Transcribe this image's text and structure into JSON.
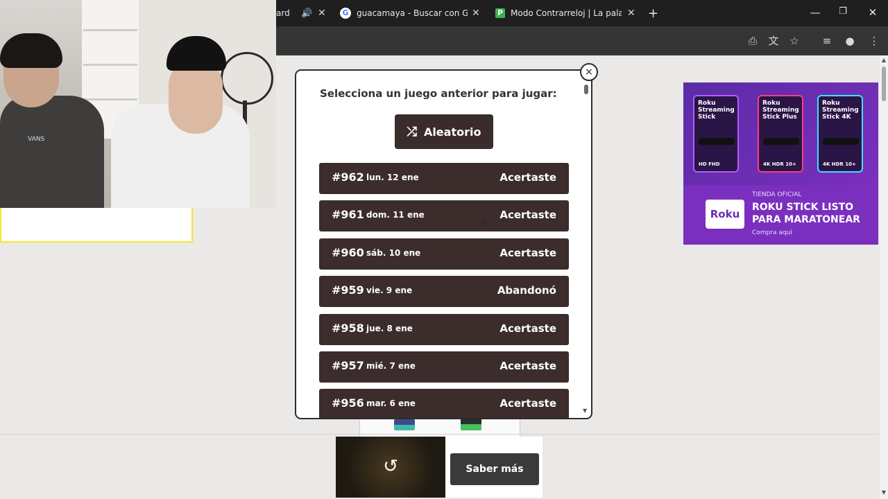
{
  "browser": {
    "tabs": [
      {
        "title": "ard",
        "favicon": "",
        "audio": true
      },
      {
        "title": "guacamaya - Buscar con Googl",
        "favicon": "G"
      },
      {
        "title": "Modo Contrarreloj | La palabra",
        "favicon": "P"
      }
    ],
    "new_tab": "+",
    "window_controls": {
      "minimize": "—",
      "restore": "❐",
      "close": "✕"
    }
  },
  "modal": {
    "title": "Selecciona un juego anterior para jugar:",
    "random_button": "Aleatorio",
    "close": "×",
    "games": [
      {
        "num": "#962",
        "date": "lun. 12 ene",
        "status": "Acertaste"
      },
      {
        "num": "#961",
        "date": "dom. 11 ene",
        "status": "Acertaste"
      },
      {
        "num": "#960",
        "date": "sáb. 10 ene",
        "status": "Acertaste"
      },
      {
        "num": "#959",
        "date": "vie. 9 ene",
        "status": "Abandonó"
      },
      {
        "num": "#958",
        "date": "jue. 8 ene",
        "status": "Acertaste"
      },
      {
        "num": "#957",
        "date": "mié. 7 ene",
        "status": "Acertaste"
      },
      {
        "num": "#956",
        "date": "mar. 6 ene",
        "status": "Acertaste"
      }
    ]
  },
  "side_ad": {
    "products": [
      "Roku Streaming Stick",
      "Roku Streaming Stick Plus",
      "Roku Streaming Stick 4K"
    ],
    "badges": [
      "HD  FHD",
      "4K  HDR 10+",
      "4K  HDR 10+"
    ],
    "logo": "Roku",
    "tag": "TIENDA OFICIAL",
    "headline": "ROKU STICK LISTO PARA MARATONEAR",
    "cta": "Compra aquí"
  },
  "bottom_ad": {
    "learn_more": "Saber más"
  },
  "webcam_shirt_text": "VANS",
  "colors": {
    "row_bg": "#3c2d2c",
    "accent_purple": "#7a2fbf"
  }
}
